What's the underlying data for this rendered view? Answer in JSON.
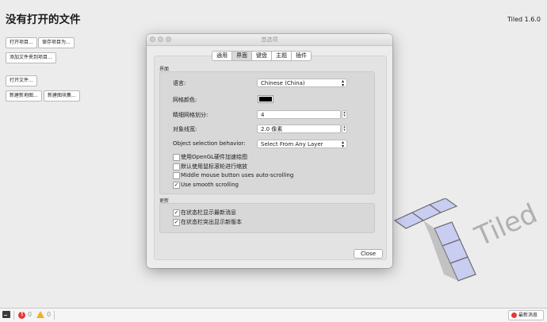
{
  "main": {
    "title": "没有打开的文件",
    "version": "Tiled 1.6.0",
    "buttons": {
      "open_project": "打开项目...",
      "save_project_as": "保存项目为...",
      "add_folder": "添加文件夹到项目...",
      "open_file": "打开文件...",
      "new_map": "新建新地图...",
      "new_tileset": "新建图块集..."
    }
  },
  "dialog": {
    "title": "首选项",
    "tabs": [
      "通用",
      "界面",
      "键盘",
      "主题",
      "插件"
    ],
    "active_tab": "界面",
    "interface_group": {
      "label": "界面",
      "language_label": "语言:",
      "language_value": "Chinese (China)",
      "grid_color_label": "网格颜色:",
      "grid_color": "#000000",
      "fine_grid_label": "精细网格划分:",
      "fine_grid_value": "4",
      "object_line_width_label": "对象线宽:",
      "object_line_width_value": "2.0 像素",
      "object_selection_label": "Object selection behavior:",
      "object_selection_value": "Select From Any Layer",
      "checkboxes": [
        {
          "label": "使用OpenGL硬件加速绘图",
          "checked": false
        },
        {
          "label": "默认使用鼠标滚轮进行缩放",
          "checked": false
        },
        {
          "label": "Middle mouse button uses auto-scrolling",
          "checked": false
        },
        {
          "label": "Use smooth scrolling",
          "checked": true
        }
      ]
    },
    "updates_group": {
      "label": "更新",
      "checkboxes": [
        {
          "label": "在状态栏显示最新消息",
          "checked": true
        },
        {
          "label": "在状态栏突出显示新版本",
          "checked": true
        }
      ]
    },
    "close_label": "Close"
  },
  "statusbar": {
    "errors": "0",
    "warnings": "0",
    "news_label": "最新消息"
  },
  "logo_text": "Tiled",
  "colors": {
    "error": "#e23a3a",
    "warning": "#f0b020",
    "logo_tile": "#c9cdf2"
  }
}
